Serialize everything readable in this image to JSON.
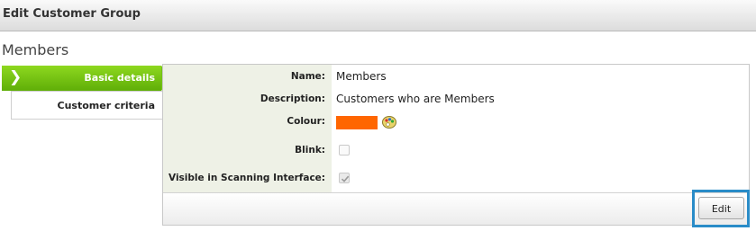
{
  "header": {
    "title": "Edit Customer Group"
  },
  "page": {
    "heading": "Members"
  },
  "sidebar": {
    "tabs": [
      {
        "label": "Basic details",
        "active": true,
        "icon": "chevron-right-icon"
      },
      {
        "label": "Customer criteria",
        "active": false
      }
    ]
  },
  "form": {
    "name": {
      "label": "Name:",
      "value": "Members"
    },
    "description": {
      "label": "Description:",
      "value": "Customers who are Members"
    },
    "colour": {
      "label": "Colour:",
      "value": "#ff6600",
      "icon": "palette-icon"
    },
    "blink": {
      "label": "Blink:",
      "checked": false
    },
    "visible": {
      "label": "Visible in Scanning Interface:",
      "checked": true
    }
  },
  "footer": {
    "edit_label": "Edit"
  },
  "colors": {
    "accent_green": "#74c314",
    "highlight_blue": "#2a8cc8",
    "label_bg": "#eef1e6"
  }
}
